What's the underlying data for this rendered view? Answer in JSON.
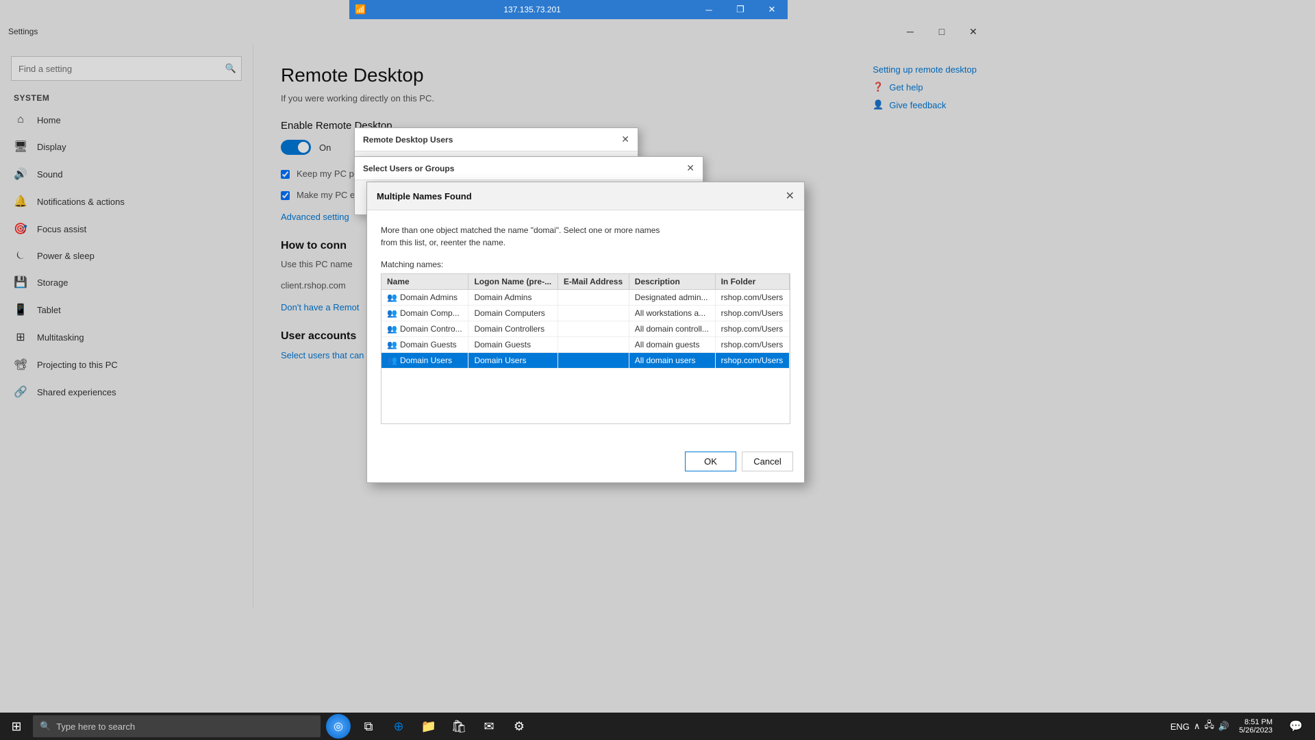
{
  "window": {
    "title": "Settings",
    "minimize": "─",
    "maximize": "□",
    "close": "✕"
  },
  "sidebar": {
    "search_placeholder": "Find a setting",
    "section": "System",
    "items": [
      {
        "id": "home",
        "label": "Home",
        "icon": "⌂"
      },
      {
        "id": "display",
        "label": "Display",
        "icon": "🖥"
      },
      {
        "id": "sound",
        "label": "Sound",
        "icon": "🔊"
      },
      {
        "id": "notifications",
        "label": "Notifications & actions",
        "icon": "🔔"
      },
      {
        "id": "focus",
        "label": "Focus assist",
        "icon": "🎯"
      },
      {
        "id": "power",
        "label": "Power & sleep",
        "icon": "⏾"
      },
      {
        "id": "storage",
        "label": "Storage",
        "icon": "💾"
      },
      {
        "id": "tablet",
        "label": "Tablet",
        "icon": "📱"
      },
      {
        "id": "multitasking",
        "label": "Multitasking",
        "icon": "⊞"
      },
      {
        "id": "projecting",
        "label": "Projecting to this PC",
        "icon": "📽"
      },
      {
        "id": "shared",
        "label": "Shared experiences",
        "icon": "🔗"
      }
    ]
  },
  "main": {
    "page_title": "Remote Desktop",
    "page_subtitle": "If you were working directly on this PC.",
    "enable_label": "Enable Remote Desktop",
    "toggle_state": "On",
    "keep_plugged": "Keep my PC plugged in",
    "make_pc": "Make my PC enable autom",
    "advanced_link": "Advanced setting",
    "how_to_connect": "How to conn",
    "use_this_pc": "Use this PC name",
    "pc_name": "client.rshop.com",
    "dont_have": "Don't have a Remot",
    "user_accounts_title": "User accounts",
    "select_users_link": "Select users that can remotely access this PC",
    "setup_link": "Setting up remote desktop",
    "get_help": "Get help",
    "give_feedback": "Give feedback"
  },
  "rdp_toolbar": {
    "ip": "137.135.73.201",
    "minimize": "─",
    "restore": "❐",
    "close": "✕"
  },
  "dialog_rdu": {
    "title": "Remote Desktop Users",
    "close": "✕"
  },
  "dialog_su": {
    "title": "Select Users or Groups",
    "close": "✕"
  },
  "dialog_mnf": {
    "title": "Multiple Names Found",
    "close": "✕",
    "description": "More than one object matched the name \"domai\". Select one or more names\nfrom this list, or, reenter the name.",
    "matching_names_label": "Matching names:",
    "columns": [
      "Name",
      "Logon Name (pre-...",
      "E-Mail Address",
      "Description",
      "In Folder"
    ],
    "rows": [
      {
        "name": "Domain Admins",
        "logon": "Domain Admins",
        "email": "",
        "description": "Designated admin...",
        "folder": "rshop.com/Users",
        "selected": false
      },
      {
        "name": "Domain Comp...",
        "logon": "Domain Computers",
        "email": "",
        "description": "All workstations a...",
        "folder": "rshop.com/Users",
        "selected": false
      },
      {
        "name": "Domain Contro...",
        "logon": "Domain Controllers",
        "email": "",
        "description": "All domain controll...",
        "folder": "rshop.com/Users",
        "selected": false
      },
      {
        "name": "Domain Guests",
        "logon": "Domain Guests",
        "email": "",
        "description": "All domain guests",
        "folder": "rshop.com/Users",
        "selected": false
      },
      {
        "name": "Domain Users",
        "logon": "Domain Users",
        "email": "",
        "description": "All domain users",
        "folder": "rshop.com/Users",
        "selected": true
      }
    ],
    "ok_label": "OK",
    "cancel_label": "Cancel"
  },
  "taskbar": {
    "search_placeholder": "Type here to search",
    "time": "8:51 PM",
    "date": "5/26/2023"
  }
}
